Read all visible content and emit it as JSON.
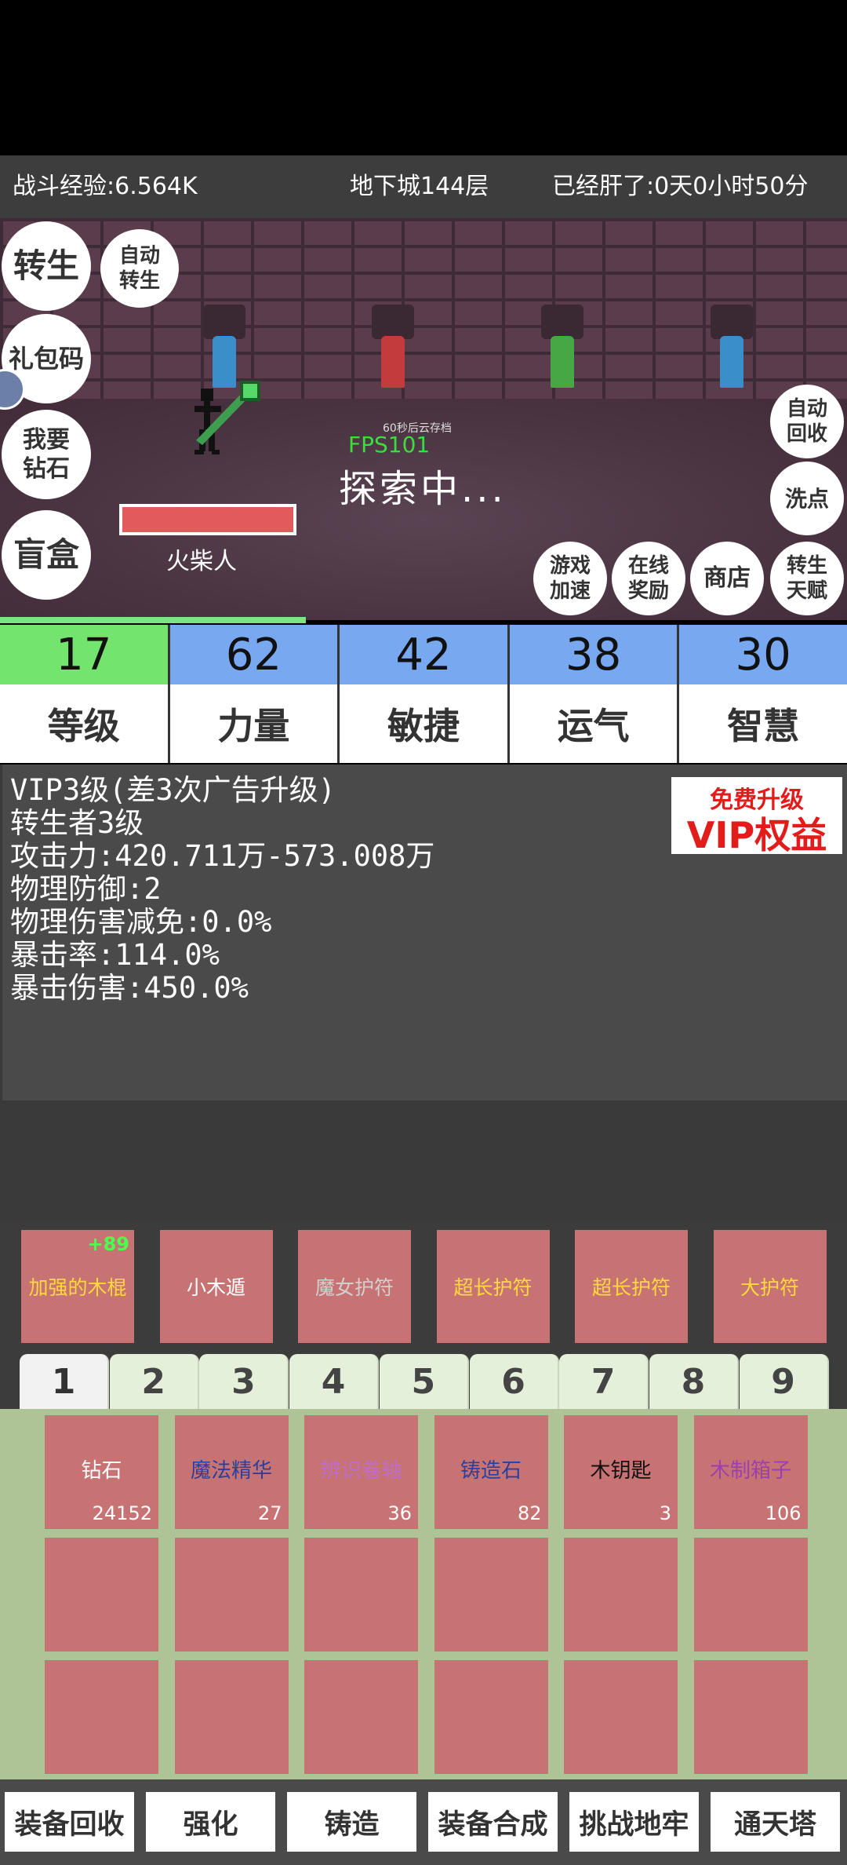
{
  "topbar": {
    "combat_exp": "战斗经验:6.564K",
    "dungeon": "地下城144层",
    "playtime": "已经肝了:0天0小时50分"
  },
  "scene": {
    "fps": "FPS101",
    "cloud_save": "60秒后云存档",
    "status": "探索中...",
    "character_name": "火柴人",
    "hp_fraction": 1.0,
    "torch_colors": [
      "#3b8fc9",
      "#c33b3b",
      "#45a845",
      "#3b8fc9"
    ]
  },
  "left_buttons": {
    "rebirth": "转生",
    "auto_rebirth_1": "自动",
    "auto_rebirth_2": "转生",
    "gift_code": "礼包码",
    "diamond_1": "我要",
    "diamond_2": "钻石",
    "blind_box": "盲盒"
  },
  "right_buttons": {
    "auto_recycle_1": "自动",
    "auto_recycle_2": "回收",
    "wash_points": "洗点",
    "speed_1": "游戏",
    "speed_2": "加速",
    "online_1": "在线",
    "online_2": "奖励",
    "shop": "商店",
    "talent_1": "转生",
    "talent_2": "天赋"
  },
  "stats": [
    {
      "value": "17",
      "label": "等级",
      "color": "#73e56f"
    },
    {
      "value": "62",
      "label": "力量",
      "color": "#78a8f0"
    },
    {
      "value": "42",
      "label": "敏捷",
      "color": "#78a8f0"
    },
    {
      "value": "38",
      "label": "运气",
      "color": "#78a8f0"
    },
    {
      "value": "30",
      "label": "智慧",
      "color": "#78a8f0"
    }
  ],
  "info": {
    "lines": [
      "VIP3级(差3次广告升级)",
      "转生者3级",
      "攻击力:420.711万-573.008万",
      "物理防御:2",
      "物理伤害减免:0.0%",
      "暴击率:114.0%",
      "暴击伤害:450.0%"
    ],
    "vip_title": "免费升级",
    "vip_sub": "VIP权益"
  },
  "equipment": [
    {
      "name": "加强的木棍",
      "bonus": "+89",
      "color": "#ffd83a"
    },
    {
      "name": "小木遁",
      "bonus": "",
      "color": "#ffffff"
    },
    {
      "name": "魔女护符",
      "bonus": "",
      "color": "#d0d0d0"
    },
    {
      "name": "超长护符",
      "bonus": "",
      "color": "#ffd83a"
    },
    {
      "name": "超长护符",
      "bonus": "",
      "color": "#ffd83a"
    },
    {
      "name": "大护符",
      "bonus": "",
      "color": "#ffd83a"
    }
  ],
  "tabs": [
    "1",
    "2",
    "3",
    "4",
    "5",
    "6",
    "7",
    "8",
    "9"
  ],
  "inventory": [
    {
      "name": "钻石",
      "count": "24152",
      "color": "#ffffff"
    },
    {
      "name": "魔法精华",
      "count": "27",
      "color": "#2a3f9e"
    },
    {
      "name": "辨识卷轴",
      "count": "36",
      "color": "#c06cc8"
    },
    {
      "name": "铸造石",
      "count": "82",
      "color": "#2a3f9e"
    },
    {
      "name": "木钥匙",
      "count": "3",
      "color": "#111111"
    },
    {
      "name": "木制箱子",
      "count": "106",
      "color": "#9b3fb0"
    }
  ],
  "bottom_buttons": [
    "装备回收",
    "强化",
    "铸造",
    "装备合成",
    "挑战地牢",
    "通天塔"
  ]
}
